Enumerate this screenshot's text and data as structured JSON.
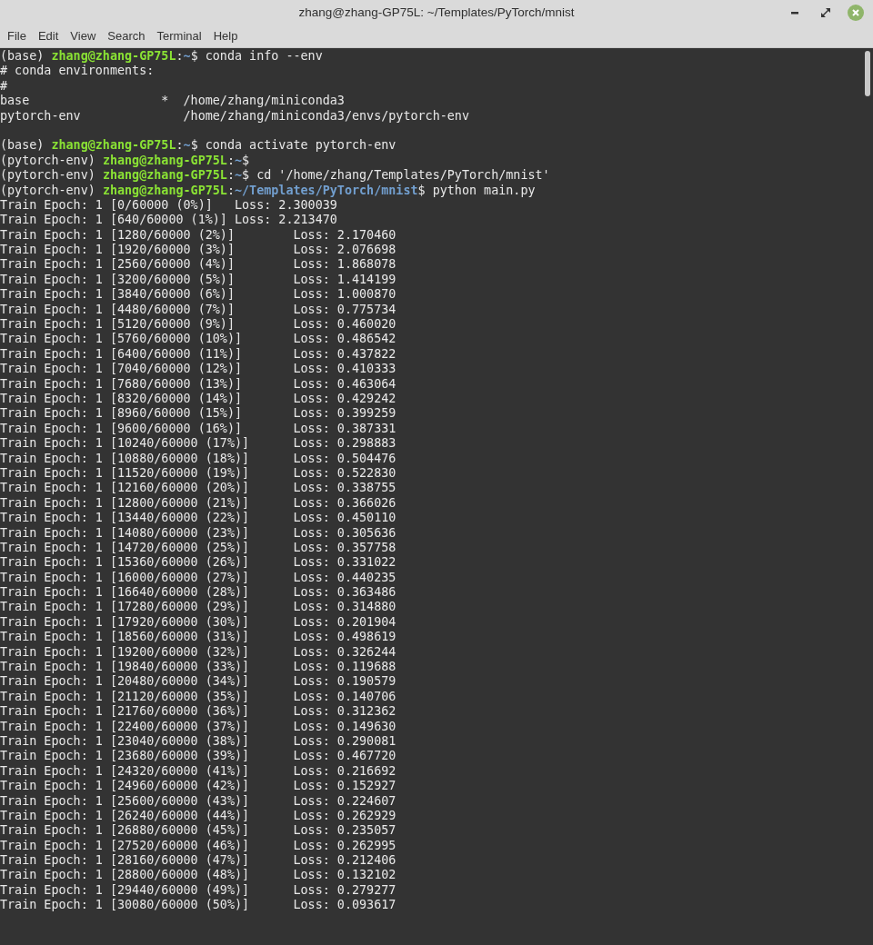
{
  "window": {
    "title": "zhang@zhang-GP75L: ~/Templates/PyTorch/mnist"
  },
  "menu": [
    "File",
    "Edit",
    "View",
    "Search",
    "Terminal",
    "Help"
  ],
  "lines": [
    {
      "kind": "prompt",
      "env": "(base)",
      "user_host": "zhang@zhang-GP75L",
      "separator": ":",
      "path": "~",
      "symbol": "$",
      "command": "conda info --env"
    },
    {
      "kind": "output",
      "text": "# conda environments:"
    },
    {
      "kind": "output",
      "text": "#"
    },
    {
      "kind": "output",
      "text": "base                  *  /home/zhang/miniconda3"
    },
    {
      "kind": "output",
      "text": "pytorch-env              /home/zhang/miniconda3/envs/pytorch-env"
    },
    {
      "kind": "blank"
    },
    {
      "kind": "prompt",
      "env": "(base)",
      "user_host": "zhang@zhang-GP75L",
      "separator": ":",
      "path": "~",
      "symbol": "$",
      "command": "conda activate pytorch-env"
    },
    {
      "kind": "prompt",
      "env": "(pytorch-env)",
      "user_host": "zhang@zhang-GP75L",
      "separator": ":",
      "path": "~",
      "symbol": "$"
    },
    {
      "kind": "prompt",
      "env": "(pytorch-env)",
      "user_host": "zhang@zhang-GP75L",
      "separator": ":",
      "path": "~",
      "symbol": "$",
      "command": "cd '/home/zhang/Templates/PyTorch/mnist'"
    },
    {
      "kind": "prompt",
      "env": "(pytorch-env)",
      "user_host": "zhang@zhang-GP75L",
      "separator": ":",
      "path": "~/Templates/PyTorch/mnist",
      "symbol": "$",
      "command": "python main.py"
    },
    {
      "kind": "output",
      "text": "Train Epoch: 1 [0/60000 (0%)]\tLoss: 2.300039"
    },
    {
      "kind": "output",
      "text": "Train Epoch: 1 [640/60000 (1%)]\tLoss: 2.213470"
    },
    {
      "kind": "output",
      "text": "Train Epoch: 1 [1280/60000 (2%)]\tLoss: 2.170460"
    },
    {
      "kind": "output",
      "text": "Train Epoch: 1 [1920/60000 (3%)]\tLoss: 2.076698"
    },
    {
      "kind": "output",
      "text": "Train Epoch: 1 [2560/60000 (4%)]\tLoss: 1.868078"
    },
    {
      "kind": "output",
      "text": "Train Epoch: 1 [3200/60000 (5%)]\tLoss: 1.414199"
    },
    {
      "kind": "output",
      "text": "Train Epoch: 1 [3840/60000 (6%)]\tLoss: 1.000870"
    },
    {
      "kind": "output",
      "text": "Train Epoch: 1 [4480/60000 (7%)]\tLoss: 0.775734"
    },
    {
      "kind": "output",
      "text": "Train Epoch: 1 [5120/60000 (9%)]\tLoss: 0.460020"
    },
    {
      "kind": "output",
      "text": "Train Epoch: 1 [5760/60000 (10%)]\tLoss: 0.486542"
    },
    {
      "kind": "output",
      "text": "Train Epoch: 1 [6400/60000 (11%)]\tLoss: 0.437822"
    },
    {
      "kind": "output",
      "text": "Train Epoch: 1 [7040/60000 (12%)]\tLoss: 0.410333"
    },
    {
      "kind": "output",
      "text": "Train Epoch: 1 [7680/60000 (13%)]\tLoss: 0.463064"
    },
    {
      "kind": "output",
      "text": "Train Epoch: 1 [8320/60000 (14%)]\tLoss: 0.429242"
    },
    {
      "kind": "output",
      "text": "Train Epoch: 1 [8960/60000 (15%)]\tLoss: 0.399259"
    },
    {
      "kind": "output",
      "text": "Train Epoch: 1 [9600/60000 (16%)]\tLoss: 0.387331"
    },
    {
      "kind": "output",
      "text": "Train Epoch: 1 [10240/60000 (17%)]\tLoss: 0.298883"
    },
    {
      "kind": "output",
      "text": "Train Epoch: 1 [10880/60000 (18%)]\tLoss: 0.504476"
    },
    {
      "kind": "output",
      "text": "Train Epoch: 1 [11520/60000 (19%)]\tLoss: 0.522830"
    },
    {
      "kind": "output",
      "text": "Train Epoch: 1 [12160/60000 (20%)]\tLoss: 0.338755"
    },
    {
      "kind": "output",
      "text": "Train Epoch: 1 [12800/60000 (21%)]\tLoss: 0.366026"
    },
    {
      "kind": "output",
      "text": "Train Epoch: 1 [13440/60000 (22%)]\tLoss: 0.450110"
    },
    {
      "kind": "output",
      "text": "Train Epoch: 1 [14080/60000 (23%)]\tLoss: 0.305636"
    },
    {
      "kind": "output",
      "text": "Train Epoch: 1 [14720/60000 (25%)]\tLoss: 0.357758"
    },
    {
      "kind": "output",
      "text": "Train Epoch: 1 [15360/60000 (26%)]\tLoss: 0.331022"
    },
    {
      "kind": "output",
      "text": "Train Epoch: 1 [16000/60000 (27%)]\tLoss: 0.440235"
    },
    {
      "kind": "output",
      "text": "Train Epoch: 1 [16640/60000 (28%)]\tLoss: 0.363486"
    },
    {
      "kind": "output",
      "text": "Train Epoch: 1 [17280/60000 (29%)]\tLoss: 0.314880"
    },
    {
      "kind": "output",
      "text": "Train Epoch: 1 [17920/60000 (30%)]\tLoss: 0.201904"
    },
    {
      "kind": "output",
      "text": "Train Epoch: 1 [18560/60000 (31%)]\tLoss: 0.498619"
    },
    {
      "kind": "output",
      "text": "Train Epoch: 1 [19200/60000 (32%)]\tLoss: 0.326244"
    },
    {
      "kind": "output",
      "text": "Train Epoch: 1 [19840/60000 (33%)]\tLoss: 0.119688"
    },
    {
      "kind": "output",
      "text": "Train Epoch: 1 [20480/60000 (34%)]\tLoss: 0.190579"
    },
    {
      "kind": "output",
      "text": "Train Epoch: 1 [21120/60000 (35%)]\tLoss: 0.140706"
    },
    {
      "kind": "output",
      "text": "Train Epoch: 1 [21760/60000 (36%)]\tLoss: 0.312362"
    },
    {
      "kind": "output",
      "text": "Train Epoch: 1 [22400/60000 (37%)]\tLoss: 0.149630"
    },
    {
      "kind": "output",
      "text": "Train Epoch: 1 [23040/60000 (38%)]\tLoss: 0.290081"
    },
    {
      "kind": "output",
      "text": "Train Epoch: 1 [23680/60000 (39%)]\tLoss: 0.467720"
    },
    {
      "kind": "output",
      "text": "Train Epoch: 1 [24320/60000 (41%)]\tLoss: 0.216692"
    },
    {
      "kind": "output",
      "text": "Train Epoch: 1 [24960/60000 (42%)]\tLoss: 0.152927"
    },
    {
      "kind": "output",
      "text": "Train Epoch: 1 [25600/60000 (43%)]\tLoss: 0.224607"
    },
    {
      "kind": "output",
      "text": "Train Epoch: 1 [26240/60000 (44%)]\tLoss: 0.262929"
    },
    {
      "kind": "output",
      "text": "Train Epoch: 1 [26880/60000 (45%)]\tLoss: 0.235057"
    },
    {
      "kind": "output",
      "text": "Train Epoch: 1 [27520/60000 (46%)]\tLoss: 0.262995"
    },
    {
      "kind": "output",
      "text": "Train Epoch: 1 [28160/60000 (47%)]\tLoss: 0.212406"
    },
    {
      "kind": "output",
      "text": "Train Epoch: 1 [28800/60000 (48%)]\tLoss: 0.132102"
    },
    {
      "kind": "output",
      "text": "Train Epoch: 1 [29440/60000 (49%)]\tLoss: 0.279277"
    },
    {
      "kind": "output",
      "text": "Train Epoch: 1 [30080/60000 (50%)]\tLoss: 0.093617"
    }
  ]
}
